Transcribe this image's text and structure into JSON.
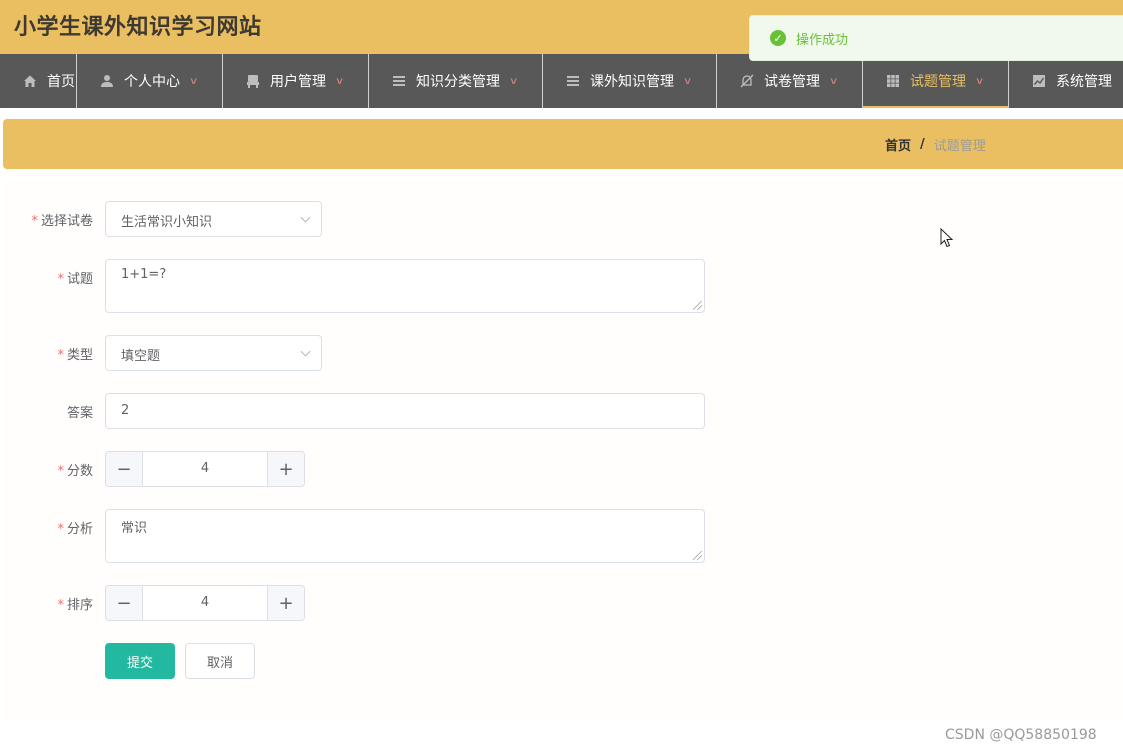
{
  "header": {
    "title": "小学生课外知识学习网站"
  },
  "toast": {
    "message": "操作成功",
    "icon": "check-circle-icon",
    "color": "#67c23a"
  },
  "nav": {
    "items": [
      {
        "label": "首页",
        "icon": "home-icon",
        "has_menu": false,
        "active": false
      },
      {
        "label": "个人中心",
        "icon": "user-icon",
        "has_menu": true,
        "active": false
      },
      {
        "label": "用户管理",
        "icon": "chair-icon",
        "has_menu": true,
        "active": false
      },
      {
        "label": "知识分类管理",
        "icon": "list-icon",
        "has_menu": true,
        "active": false
      },
      {
        "label": "课外知识管理",
        "icon": "list-icon",
        "has_menu": true,
        "active": false
      },
      {
        "label": "试卷管理",
        "icon": "bell-off-icon",
        "has_menu": true,
        "active": false
      },
      {
        "label": "试题管理",
        "icon": "grid-icon",
        "has_menu": true,
        "active": true
      },
      {
        "label": "系统管理",
        "icon": "chart-icon",
        "has_menu": false,
        "active": false
      }
    ]
  },
  "breadcrumb": {
    "home": "首页",
    "separator": "/",
    "current": "试题管理"
  },
  "form": {
    "paper": {
      "label": "选择试卷",
      "required": true,
      "value": "生活常识小知识"
    },
    "question": {
      "label": "试题",
      "required": true,
      "value": "1+1=?"
    },
    "type": {
      "label": "类型",
      "required": true,
      "value": "填空题"
    },
    "answer": {
      "label": "答案",
      "required": false,
      "value": "2"
    },
    "score": {
      "label": "分数",
      "required": true,
      "value": "4",
      "minus": "−",
      "plus": "+"
    },
    "analysis": {
      "label": "分析",
      "required": true,
      "value": "常识"
    },
    "order": {
      "label": "排序",
      "required": true,
      "value": "4",
      "minus": "−",
      "plus": "+"
    },
    "required_mark": "*"
  },
  "buttons": {
    "submit": "提交",
    "cancel": "取消"
  },
  "colors": {
    "accent": "#e9bf62",
    "nav_bg": "#585858",
    "primary_button": "#22b9a0"
  },
  "watermark": "CSDN @QQ58850198"
}
